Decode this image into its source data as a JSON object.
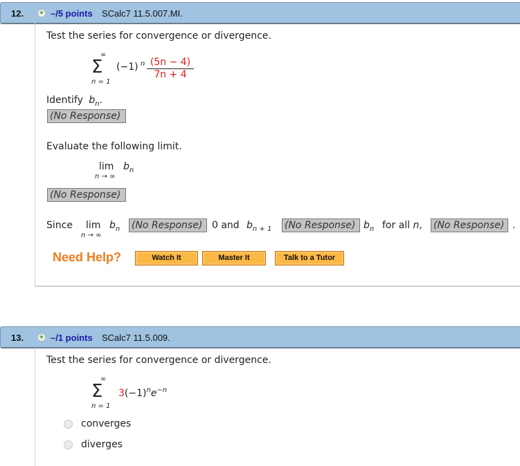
{
  "questions": [
    {
      "number": "12.",
      "points": "–/5 points",
      "code": "SCalc7 11.5.007.MI.",
      "prompt": "Test the series for convergence or divergence.",
      "series": {
        "upper": "∞",
        "lower": "n = 1",
        "sigma": "Σ",
        "sign_factor": "(−1)",
        "exponent": "n",
        "numerator": "(5n − 4)",
        "denominator": "7n + 4"
      },
      "identify_label": "Identify",
      "identify_var": "b",
      "identify_sub": "n",
      "identify_end": ".",
      "identify_response": "(No Response)",
      "limit_prompt": "Evaluate the following limit.",
      "limit": {
        "lim": "lim",
        "under": "n → ∞",
        "var": "b",
        "sub": "n"
      },
      "limit_response": "(No Response)",
      "since": {
        "since_label": "Since",
        "lim": "lim",
        "under": "n → ∞",
        "var": "b",
        "sub": "n",
        "response1": "(No Response)",
        "zero_and": "0 and",
        "var2": "b",
        "sub2": "n + 1",
        "response2": "(No Response)",
        "var3": "b",
        "sub3": "n",
        "for_all": "for all",
        "n_var": "n",
        "comma": ",",
        "response3": "(No Response)",
        "period": "."
      },
      "help": {
        "label": "Need Help?",
        "buttons": [
          "Watch It",
          "Master It",
          "Talk to a Tutor"
        ]
      }
    },
    {
      "number": "13.",
      "points": "–/1 points",
      "code": "SCalc7 11.5.009.",
      "prompt": "Test the series for convergence or divergence.",
      "series": {
        "upper": "∞",
        "lower": "n = 1",
        "sigma": "Σ",
        "coef": "3",
        "term": "(−1)",
        "exp1": "n",
        "base2": "e",
        "exp2": "−n"
      },
      "options": [
        "converges",
        "diverges"
      ]
    }
  ]
}
